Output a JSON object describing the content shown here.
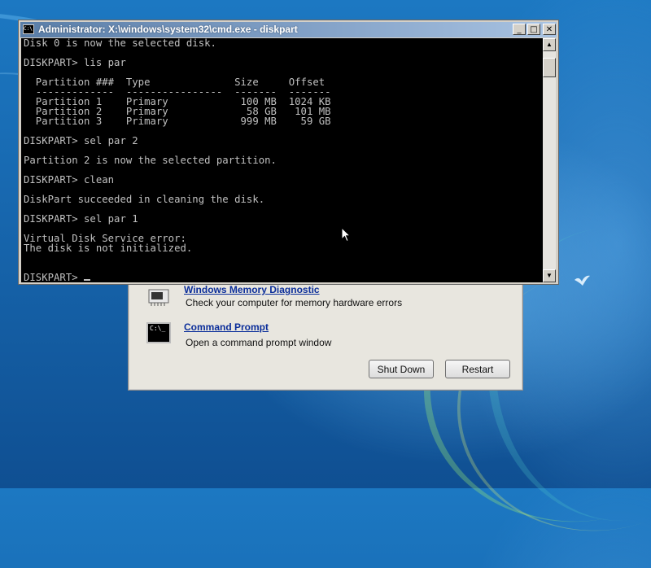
{
  "cmd_window": {
    "title": "Administrator: X:\\windows\\system32\\cmd.exe - diskpart",
    "icon_text": "C:\\",
    "minimize_label": "_",
    "maximize_label": "□",
    "close_label": "✕",
    "lines": [
      "Disk 0 is now the selected disk.",
      "",
      "DISKPART> lis par",
      "",
      "  Partition ###  Type              Size     Offset",
      "  -------------  ----------------  -------  -------",
      "  Partition 1    Primary            100 MB  1024 KB",
      "  Partition 2    Primary             58 GB   101 MB",
      "  Partition 3    Primary            999 MB    59 GB",
      "",
      "DISKPART> sel par 2",
      "",
      "Partition 2 is now the selected partition.",
      "",
      "DISKPART> clean",
      "",
      "DiskPart succeeded in cleaning the disk.",
      "",
      "DISKPART> sel par 1",
      "",
      "Virtual Disk Service error:",
      "The disk is not initialized.",
      "",
      ""
    ],
    "prompt": "DISKPART> "
  },
  "recovery_dialog": {
    "items": [
      {
        "title": "Windows Memory Diagnostic",
        "description": "Check your computer for memory hardware errors"
      },
      {
        "title": "Command Prompt",
        "description": "Open a command prompt window",
        "icon_text": "C:\\_"
      }
    ],
    "shutdown_label": "Shut Down",
    "restart_label": "Restart"
  }
}
